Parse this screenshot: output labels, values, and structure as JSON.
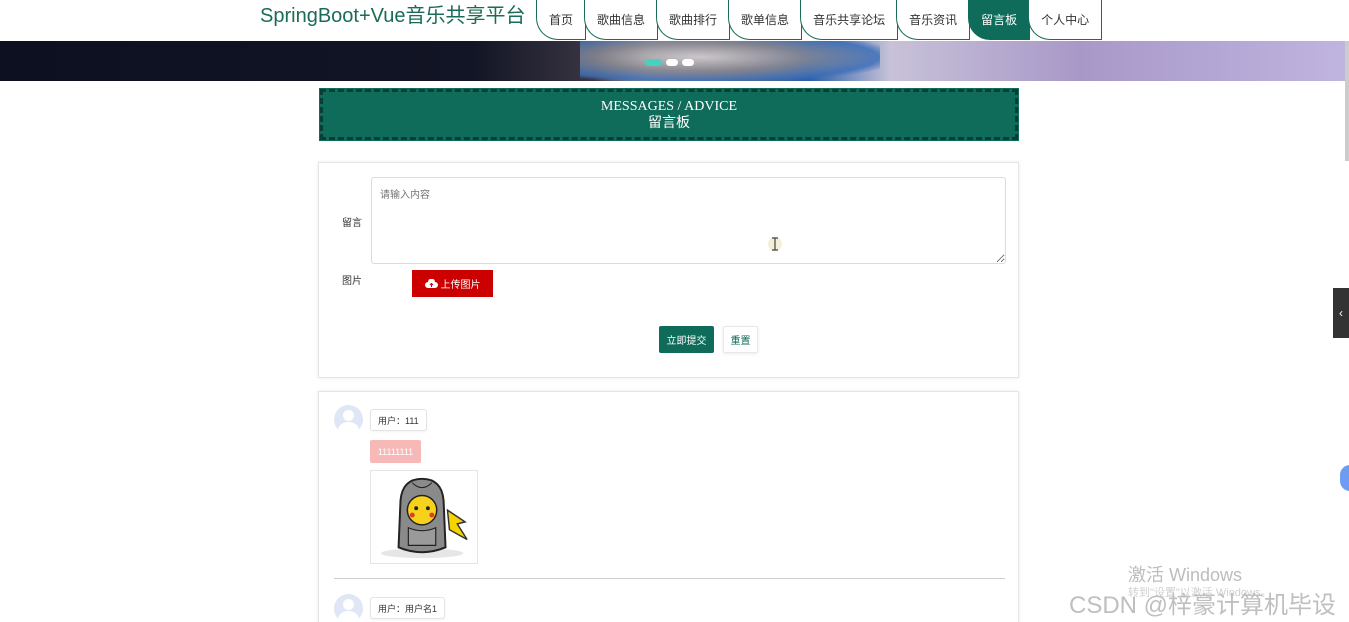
{
  "header": {
    "brand": "SpringBoot+Vue音乐共享平台",
    "nav": [
      {
        "label": "首页",
        "active": false
      },
      {
        "label": "歌曲信息",
        "active": false
      },
      {
        "label": "歌曲排行",
        "active": false
      },
      {
        "label": "歌单信息",
        "active": false
      },
      {
        "label": "音乐共享论坛",
        "active": false
      },
      {
        "label": "音乐资讯",
        "active": false
      },
      {
        "label": "留言板",
        "active": true
      },
      {
        "label": "个人中心",
        "active": false
      }
    ]
  },
  "carousel": {
    "slide_count": 3,
    "active_index": 0
  },
  "title": {
    "en": "MESSAGES / ADVICE",
    "cn": "留言板"
  },
  "form": {
    "message_label": "留言",
    "message_placeholder": "请输入内容",
    "image_label": "图片",
    "upload_label": "上传图片",
    "submit_label": "立即提交",
    "reset_label": "重置"
  },
  "comments": [
    {
      "user": "用户：111",
      "content": "11111111",
      "has_image": true
    },
    {
      "user": "用户：用户名1",
      "content": "",
      "has_image": false
    }
  ],
  "watermark": {
    "activate": "激活 Windows",
    "activate_hint": "转到\"设置\"以激活 Windows。",
    "csdn": "CSDN @梓豪计算机毕设"
  },
  "colors": {
    "primary": "#0f6b5a",
    "upload": "#cc0000",
    "content_tag": "#f7b8b8"
  }
}
